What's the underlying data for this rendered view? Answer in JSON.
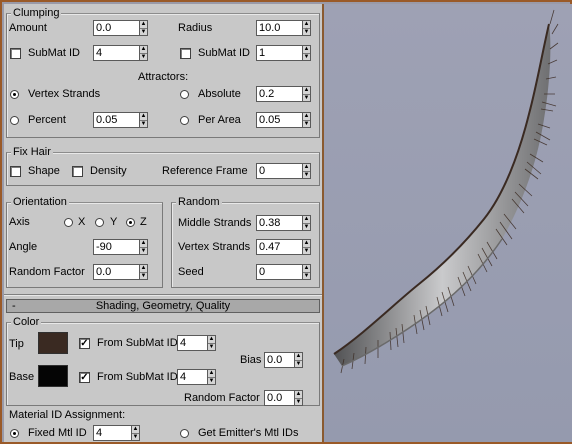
{
  "clumping": {
    "legend": "Clumping",
    "amount_label": "Amount",
    "amount_value": "0.0",
    "radius_label": "Radius",
    "radius_value": "10.0",
    "submat_id_label_1": "SubMat ID",
    "submat_id_value_1": "4",
    "submat_id_label_2": "SubMat ID",
    "submat_id_value_2": "1",
    "attractors_label": "Attractors:",
    "vertex_strands_label": "Vertex Strands",
    "absolute_label": "Absolute",
    "absolute_value": "0.2",
    "percent_label": "Percent",
    "percent_value": "0.05",
    "per_area_label": "Per Area",
    "per_area_value": "0.05"
  },
  "fix_hair": {
    "legend": "Fix Hair",
    "shape_label": "Shape",
    "density_label": "Density",
    "reference_frame_label": "Reference Frame",
    "reference_frame_value": "0"
  },
  "orientation": {
    "legend": "Orientation",
    "axis_label": "Axis",
    "x_label": "X",
    "y_label": "Y",
    "z_label": "Z",
    "angle_label": "Angle",
    "angle_value": "-90",
    "random_factor_label": "Random Factor",
    "random_factor_value": "0.0"
  },
  "random": {
    "legend": "Random",
    "middle_strands_label": "Middle Strands",
    "middle_strands_value": "0.38",
    "vertex_strands_label": "Vertex Strands",
    "vertex_strands_value": "0.47",
    "seed_label": "Seed",
    "seed_value": "0"
  },
  "rollout": {
    "collapse_symbol": "-",
    "title": "Shading, Geometry, Quality"
  },
  "color": {
    "legend": "Color",
    "tip_label": "Tip",
    "tip_color": "#3a2a22",
    "tip_from_submat_label": "From SubMat ID",
    "tip_submat_value": "4",
    "bias_label": "Bias",
    "bias_value": "0.0",
    "base_label": "Base",
    "base_color": "#050505",
    "base_from_submat_label": "From SubMat ID",
    "base_submat_value": "4",
    "random_factor_label": "Random Factor",
    "random_factor_value": "0.0",
    "material_id_label": "Material ID Assignment:",
    "fixed_mtl_id_label": "Fixed Mtl ID",
    "fixed_mtl_id_value": "4",
    "get_emitter_label": "Get Emitter's Mtl IDs"
  },
  "icons": {
    "spinner_up": "▲",
    "spinner_down": "▼",
    "check": "✓"
  }
}
